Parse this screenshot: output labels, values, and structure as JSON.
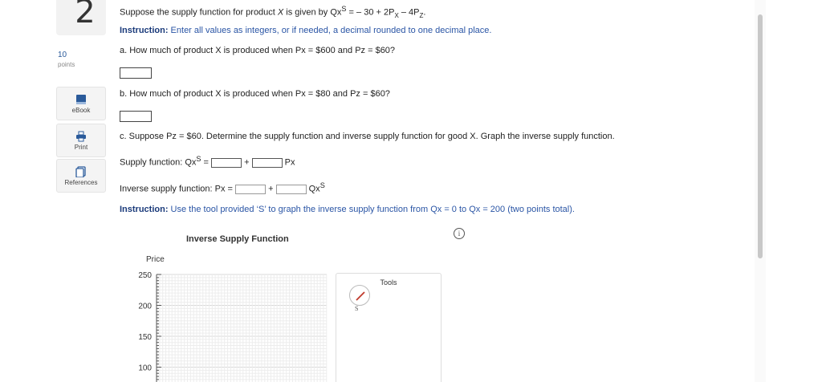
{
  "question": {
    "number": "2",
    "points_value": "10",
    "points_label": "points"
  },
  "sidebar": {
    "tools": [
      {
        "label": "eBook",
        "icon": "book-icon"
      },
      {
        "label": "Print",
        "icon": "printer-icon"
      },
      {
        "label": "References",
        "icon": "references-icon"
      }
    ]
  },
  "prompt": {
    "supply_lead": "Suppose the supply function for product ",
    "supply_var": "X",
    "supply_mid": " is given by Qx",
    "supply_sup": "S",
    "supply_eq": " = – 30 + 2P",
    "px_sub": "X",
    "supply_eq2": " – 4P",
    "pz_sub": "Z",
    "supply_end": ".",
    "instruction_bold": "Instruction:",
    "instruction_text": " Enter all values as integers, or if needed, a decimal rounded to one decimal place.",
    "part_a": "a. How much of product X is produced when Px = $600 and Pz = $60?",
    "part_b": "b. How much of product X is produced when Px = $80 and Pz = $60?",
    "part_c": "c. Suppose Pz = $60. Determine the supply function and inverse supply function for good X. Graph the inverse supply function.",
    "supply_fn_label": "Supply function: Qx",
    "supply_fn_sup": "S",
    "supply_fn_eq": " =",
    "plus": "+",
    "px_term": "Px",
    "inverse_label": "Inverse supply function: Px =",
    "qxs_term": "Qx",
    "qxs_sup": "S",
    "instruction2_bold": "Instruction:",
    "instruction2_text": " Use the tool provided ‘S’ to graph the inverse supply function from Qx = 0 to Qx = 200 (two points total)."
  },
  "answers": {
    "a": "",
    "b": "",
    "supply_intercept": "",
    "supply_slope": "",
    "inverse_intercept": "",
    "inverse_slope": ""
  },
  "chart": {
    "title": "Inverse Supply Function",
    "ylabel": "Price",
    "yticks": [
      "250",
      "200",
      "150",
      "100"
    ],
    "info_icon": "i"
  },
  "tools_panel": {
    "title": "Tools",
    "tool_label": "S",
    "tool_icon": "line-draw-icon",
    "tool_color": "#c0392b"
  },
  "chart_data": {
    "type": "line",
    "title": "Inverse Supply Function",
    "xlabel": "",
    "ylabel": "Price",
    "yticks": [
      250,
      200,
      150,
      100
    ],
    "grid": true,
    "series": []
  }
}
